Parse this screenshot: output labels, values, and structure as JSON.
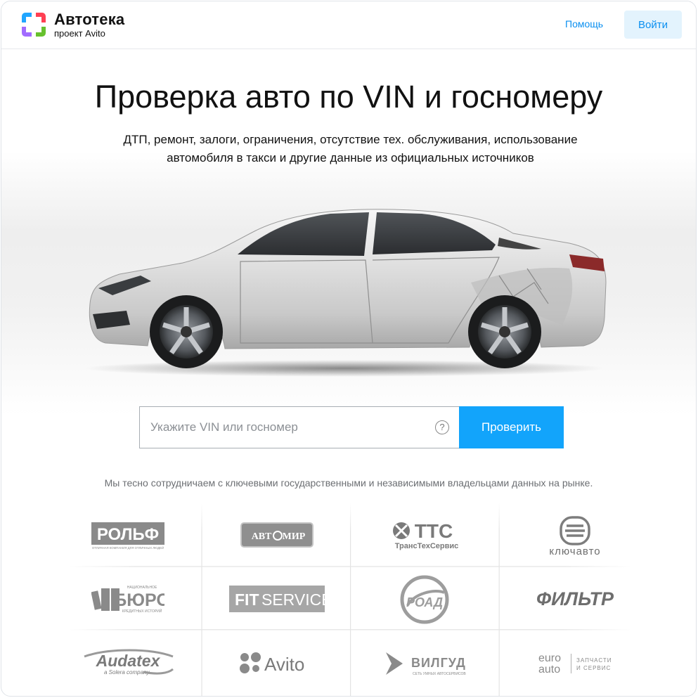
{
  "header": {
    "logo_title": "Автотека",
    "logo_subtitle": "проект Avito",
    "help_label": "Помощь",
    "login_label": "Войти"
  },
  "hero": {
    "title": "Проверка авто по VIN и госномеру",
    "subtitle": "ДТП, ремонт, залоги, ограничения, отсутствие тех. обслуживания, использование автомобиля в такси и другие данные из официальных источников"
  },
  "search": {
    "placeholder": "Укажите VIN или госномер",
    "value": "",
    "help_glyph": "?",
    "button_label": "Проверить"
  },
  "partners": {
    "note": "Мы тесно сотрудничаем с ключевыми государственными и независимыми владельцами данных на рынке.",
    "logos": {
      "rolf": {
        "name": "РОЛЬФ",
        "tagline": "ОТЛИЧНАЯ КОМПАНИЯ ДЛЯ ОТЛИЧНЫХ ЛЮДЕЙ"
      },
      "avtomir": {
        "name_left": "АВТ",
        "name_right": "МИР"
      },
      "tts": {
        "name": "TTC",
        "tagline": "ТрансТехСервис"
      },
      "klyuchavto": {
        "name": "ключавто"
      },
      "nbki": {
        "top": "НАЦИОНАЛЬНОЕ",
        "name": "БЮРО",
        "tagline": "КРЕДИТНЫХ ИСТОРИЙ"
      },
      "fitservice": {
        "name_a": "FIT",
        "name_b": "SERVICE"
      },
      "road": {
        "name": "РОАД"
      },
      "filtr": {
        "name": "ФИЛЬТР"
      },
      "audatex": {
        "name": "Audatex",
        "tagline": "a Solera company"
      },
      "avito": {
        "name": "Avito"
      },
      "vilgud": {
        "name": "ВИЛГУД",
        "tagline": "СЕТЬ УМНЫХ АВТОСЕРВИСОВ"
      },
      "euroauto": {
        "name_a": "euro",
        "name_b": "auto",
        "tagline_a": "ЗАПЧАСТИ",
        "tagline_b": "И СЕРВИС"
      }
    }
  },
  "colors": {
    "accent": "#12a4fb",
    "link": "#0a8ff0",
    "login_bg": "#e3f3fd",
    "logo_blue": "#20a6ff",
    "logo_red": "#ff4053",
    "logo_purple": "#a26bff",
    "logo_green": "#67c12e"
  }
}
